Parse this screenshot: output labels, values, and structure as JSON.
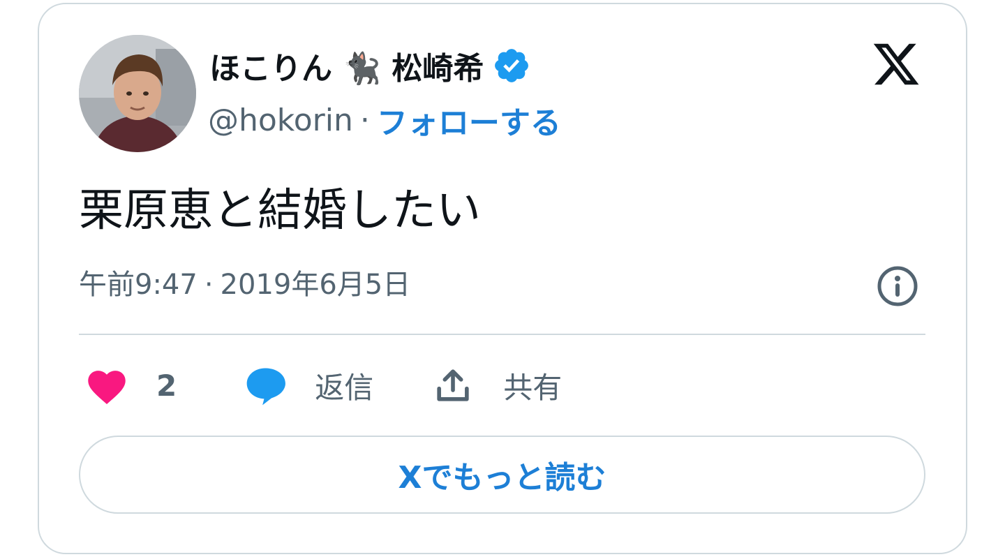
{
  "author": {
    "display_name": "ほこりん 🐈‍⬛ 松崎希",
    "handle": "@hokorin",
    "separator": "·",
    "follow_label": "フォローする",
    "verified": true
  },
  "tweet": {
    "text": "栗原恵と結婚したい",
    "time": "午前9:47",
    "separator": "·",
    "date": "2019年6月5日"
  },
  "actions": {
    "likes": "2",
    "reply_label": "返信",
    "share_label": "共有"
  },
  "read_more_label": "Xでもっと読む",
  "colors": {
    "accent": "#1d7fd6",
    "like": "#f91880",
    "reply": "#1d9bf0",
    "secondary_text": "#536471",
    "border": "#cfd9de"
  },
  "icons": [
    "avatar",
    "verified-badge-icon",
    "x-logo-icon",
    "info-icon",
    "heart-icon",
    "reply-bubble-icon",
    "share-icon"
  ]
}
